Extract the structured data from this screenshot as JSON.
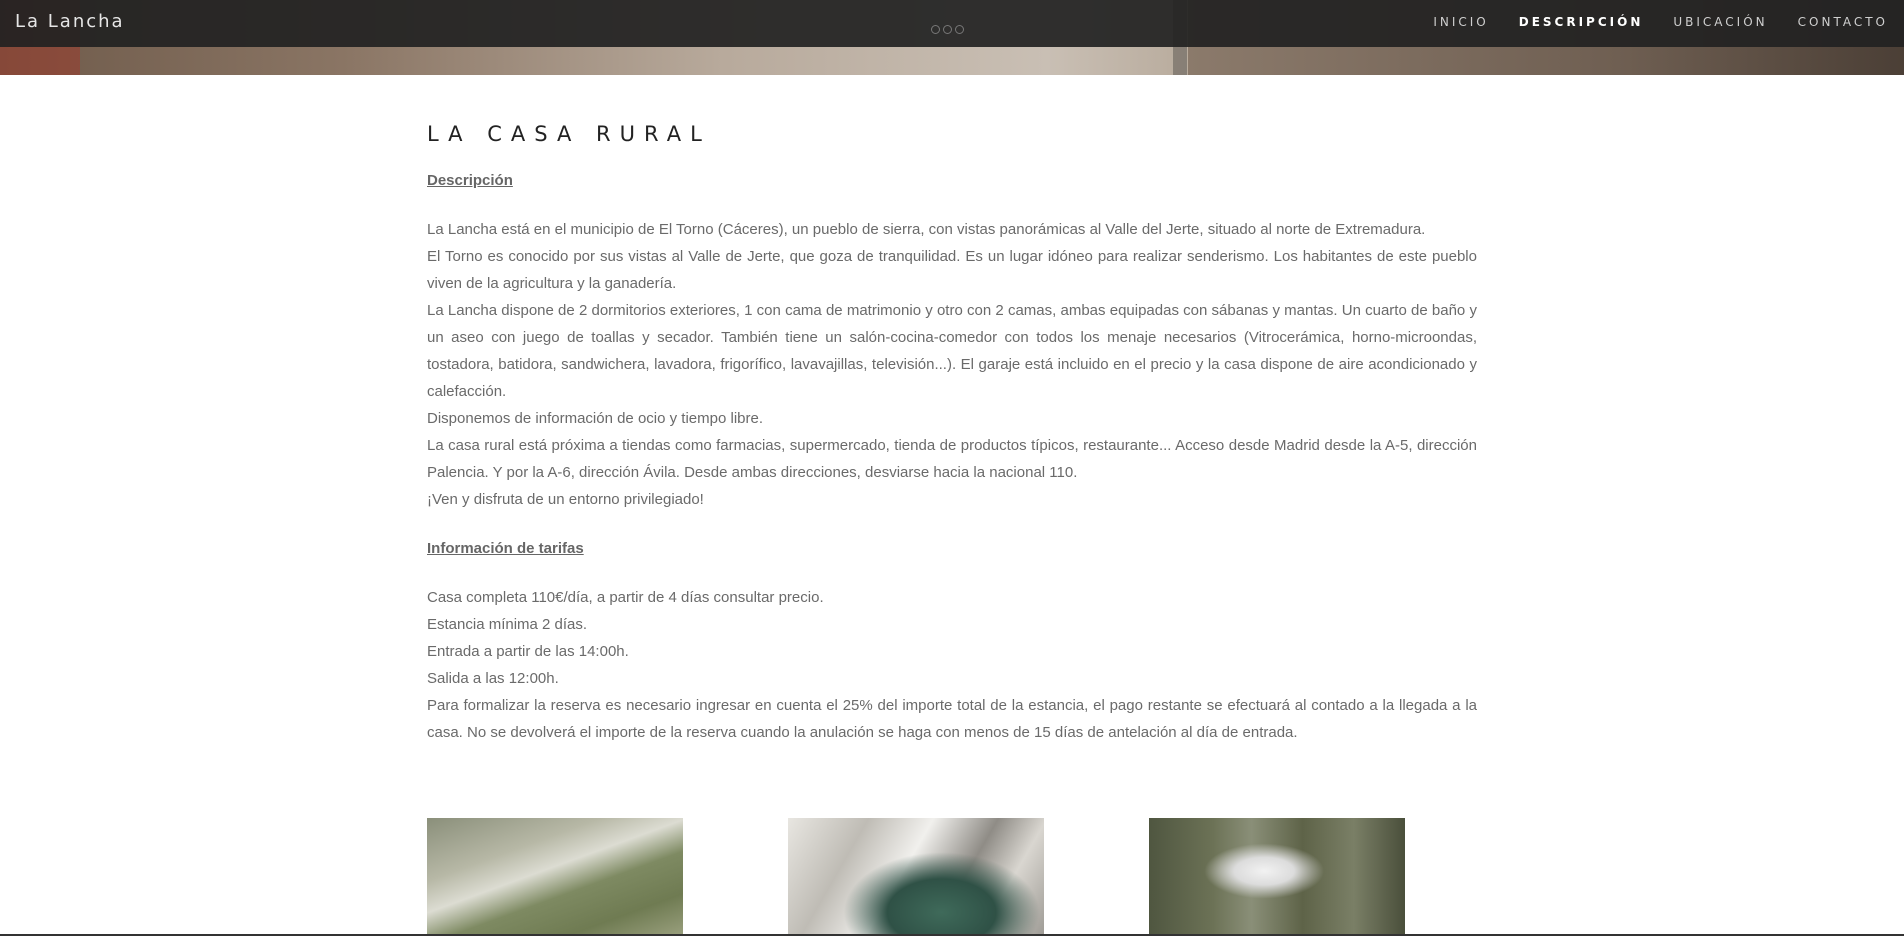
{
  "navbar": {
    "brand": "La Lancha",
    "items": [
      {
        "label": "INICIO"
      },
      {
        "label": "DESCRIPCIÓN",
        "active": true
      },
      {
        "label": "UBICACIÓN"
      },
      {
        "label": "CONTACTO"
      }
    ]
  },
  "main": {
    "title": "LA CASA RURAL",
    "description_heading": "Descripción",
    "description": [
      "La Lancha está en el municipio de El Torno (Cáceres), un pueblo de sierra, con vistas panorámicas al Valle del Jerte, situado al norte de Extremadura.",
      "El Torno es conocido por sus vistas al Valle de Jerte, que goza de tranquilidad. Es un lugar idóneo para realizar senderismo. Los habitantes de este pueblo viven de la agricultura y la ganadería.",
      "La Lancha dispone de 2 dormitorios exteriores, 1 con cama de matrimonio y otro con 2 camas, ambas equipadas con sábanas y mantas. Un cuarto de baño y un aseo con juego de toallas y secador. También tiene un salón-cocina-comedor con todos los menaje necesarios (Vitrocerámica, horno-microondas, tostadora, batidora, sandwichera, lavadora, frigorífico, lavavajillas, televisión...). El garaje está incluido en el precio y la casa dispone de aire acondicionado y calefacción.",
      "Disponemos de información de ocio y tiempo libre.",
      "La casa rural está próxima a tiendas como farmacias, supermercado, tienda de productos típicos, restaurante... Acceso desde Madrid desde la A-5, dirección Palencia. Y por la A-6, dirección Ávila. Desde ambas direcciones, desviarse hacia la nacional 110.",
      "¡Ven y disfruta de un entorno privilegiado!"
    ],
    "rates_heading": "Información de tarifas",
    "rates": [
      "Casa completa 110€/día, a partir de 4 días consultar precio.",
      "Estancia mínima 2 días.",
      "Entrada a partir de las 14:00h.",
      "Salida a las 12:00h.",
      "Para formalizar la reserva es necesario ingresar en cuenta el 25% del importe total de la estancia, el pago restante se efectuará al contado a la llegada a la casa. No se devolverá el importe de la reserva cuando la anulación se haga con menos de 15 días de antelación al día de entrada."
    ]
  }
}
